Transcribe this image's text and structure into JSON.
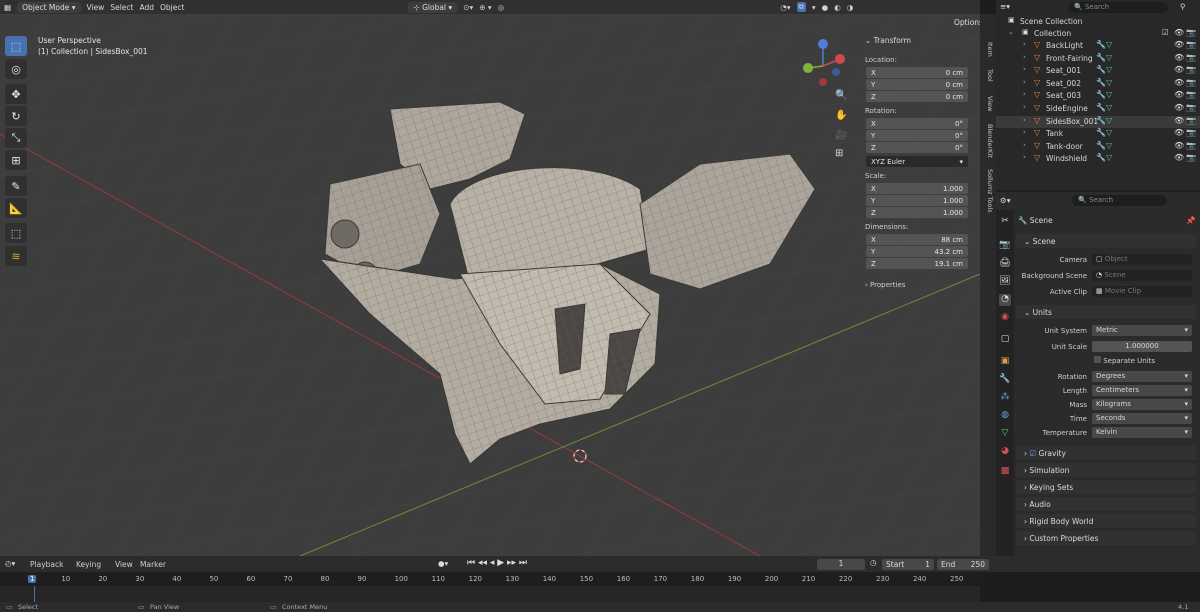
{
  "header": {
    "mode": "Object Mode",
    "menus": [
      "View",
      "Select",
      "Add",
      "Object"
    ],
    "orientation": "Global",
    "options": "Options"
  },
  "viewport": {
    "perspective": "User Perspective",
    "collection": "(1) Collection | SidesBox_001"
  },
  "npanel": {
    "title": "Transform",
    "location_label": "Location:",
    "location": [
      {
        "axis": "X",
        "value": "0 cm"
      },
      {
        "axis": "Y",
        "value": "0 cm"
      },
      {
        "axis": "Z",
        "value": "0 cm"
      }
    ],
    "rotation_label": "Rotation:",
    "rotation": [
      {
        "axis": "X",
        "value": "0°"
      },
      {
        "axis": "Y",
        "value": "0°"
      },
      {
        "axis": "Z",
        "value": "0°"
      }
    ],
    "rotation_mode": "XYZ Euler",
    "scale_label": "Scale:",
    "scale": [
      {
        "axis": "X",
        "value": "1.000"
      },
      {
        "axis": "Y",
        "value": "1.000"
      },
      {
        "axis": "Z",
        "value": "1.000"
      }
    ],
    "dimensions_label": "Dimensions:",
    "dimensions": [
      {
        "axis": "X",
        "value": "88 cm"
      },
      {
        "axis": "Y",
        "value": "43.2 cm"
      },
      {
        "axis": "Z",
        "value": "19.1 cm"
      }
    ],
    "properties": "Properties"
  },
  "side_tabs": [
    "Item",
    "Tool",
    "View",
    "BlenderKit",
    "Sollumz Tools"
  ],
  "outliner": {
    "search": "Search",
    "scene_collection": "Scene Collection",
    "collection": "Collection",
    "items": [
      "BackLight",
      "Front-Fairing",
      "Seat_001",
      "Seat_002",
      "Seat_003",
      "SideEngine",
      "SidesBox_001",
      "Tank",
      "Tank-door",
      "Windshield"
    ]
  },
  "properties": {
    "search": "Search",
    "context": "Scene",
    "scene_section": "Scene",
    "camera_label": "Camera",
    "camera_value": "Object",
    "bg_label": "Background Scene",
    "bg_value": "Scene",
    "clip_label": "Active Clip",
    "clip_value": "Movie Clip",
    "units_section": "Units",
    "unit_system_label": "Unit System",
    "unit_system": "Metric",
    "unit_scale_label": "Unit Scale",
    "unit_scale": "1.000000",
    "separate_units": "Separate Units",
    "rotation_label": "Rotation",
    "rotation": "Degrees",
    "length_label": "Length",
    "length": "Centimeters",
    "mass_label": "Mass",
    "mass": "Kilograms",
    "time_label": "Time",
    "time": "Seconds",
    "temperature_label": "Temperature",
    "temperature": "Kelvin",
    "collapsed": [
      "Gravity",
      "Simulation",
      "Keying Sets",
      "Audio",
      "Rigid Body World",
      "Custom Properties"
    ]
  },
  "timeline": {
    "menus": [
      "Playback",
      "Keying",
      "View",
      "Marker"
    ],
    "current_frame": "1",
    "start_label": "Start",
    "start": "1",
    "end_label": "End",
    "end": "250",
    "ticks": [
      "1",
      "10",
      "20",
      "30",
      "40",
      "50",
      "60",
      "70",
      "80",
      "90",
      "100",
      "110",
      "120",
      "130",
      "140",
      "150",
      "160",
      "170",
      "180",
      "190",
      "200",
      "210",
      "220",
      "230",
      "240",
      "250"
    ]
  },
  "status": {
    "select": "Select",
    "pan": "Pan View",
    "context": "Context Menu",
    "version": "4.1"
  },
  "colors": {
    "accent": "#4772b3",
    "mesh": "#b9b2a8",
    "x_axis": "#c0473f",
    "y_axis": "#7da83a"
  }
}
